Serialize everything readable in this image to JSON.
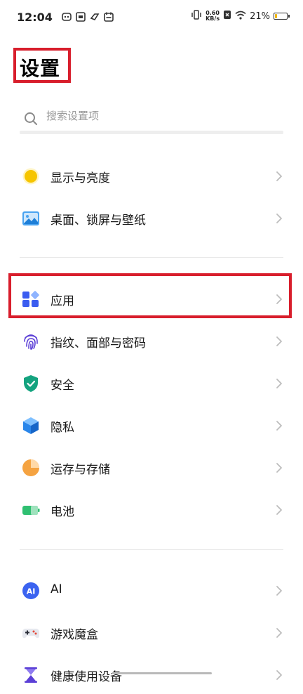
{
  "status_bar": {
    "time": "12:04",
    "net_speed_value": "0.60",
    "net_speed_unit": "KB/s",
    "battery_percent": "21%",
    "battery_level": 0.21
  },
  "header": {
    "title": "设置"
  },
  "search": {
    "placeholder": "搜索设置项"
  },
  "items": [
    {
      "label": "显示与亮度"
    },
    {
      "label": "桌面、锁屏与壁纸"
    },
    {
      "label": "应用"
    },
    {
      "label": "指纹、面部与密码"
    },
    {
      "label": "安全"
    },
    {
      "label": "隐私"
    },
    {
      "label": "运存与存储"
    },
    {
      "label": "电池"
    },
    {
      "label": "AI"
    },
    {
      "label": "游戏魔盒"
    },
    {
      "label": "健康使用设备"
    }
  ],
  "colors": {
    "highlight": "#d81e2c",
    "accent_blue": "#3b82f6",
    "security_green": "#14a37f",
    "storage_orange": "#f5a341",
    "battery_green": "#2fbf71",
    "display_yellow": "#f6c500"
  }
}
